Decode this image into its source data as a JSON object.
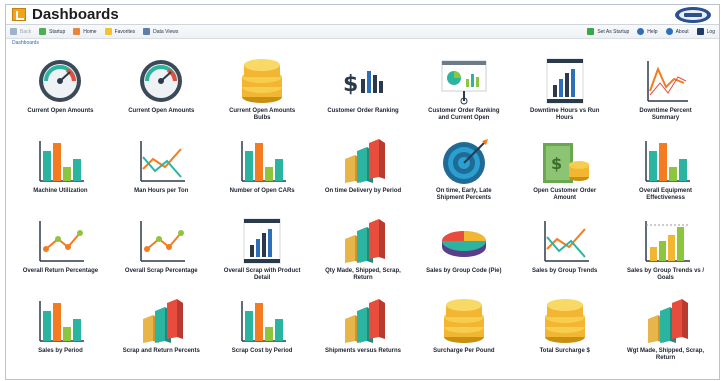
{
  "app": {
    "title": "Dashboards"
  },
  "toolbar": {
    "back": "Back",
    "startup": "Startup",
    "home": "Home",
    "favorites": "Favorites",
    "data_views": "Data Views",
    "set_as_startup": "Set As Startup",
    "help": "Help",
    "about": "About",
    "log": "Log"
  },
  "breadcrumb": "Dashboards",
  "tiles": [
    {
      "label": "Current Open Amounts",
      "icon": "gauge-icon"
    },
    {
      "label": "Current Open Amounts",
      "icon": "gauge-icon"
    },
    {
      "label": "Current Open Amounts Bulbs",
      "icon": "coins-icon"
    },
    {
      "label": "Customer Order Ranking",
      "icon": "dollar-bars-icon"
    },
    {
      "label": "Customer Order Ranking and Current Open",
      "icon": "presentation-icon"
    },
    {
      "label": "Downtime Hours vs Run Hours",
      "icon": "bar-board-icon"
    },
    {
      "label": "Downtime Percent Summary",
      "icon": "trend-line-icon"
    },
    {
      "label": "Machine Utilization",
      "icon": "bar-chart-icon"
    },
    {
      "label": "Man Hours per Ton",
      "icon": "line-chart-icon"
    },
    {
      "label": "Number of Open CARs",
      "icon": "bar-chart-icon"
    },
    {
      "label": "On time Delivery by Period",
      "icon": "3d-bars-icon"
    },
    {
      "label": "On time, Early, Late Shipment Percents",
      "icon": "target-icon"
    },
    {
      "label": "Open Customer Order Amount",
      "icon": "money-icon"
    },
    {
      "label": "Overall Equipment Effectiveness",
      "icon": "bar-chart-icon"
    },
    {
      "label": "Overall Return Percentage",
      "icon": "dot-line-icon"
    },
    {
      "label": "Overall Scrap Percentage",
      "icon": "dot-line-icon"
    },
    {
      "label": "Overall Scrap with Product Detail",
      "icon": "bar-board-icon"
    },
    {
      "label": "Qty Made, Shipped, Scrap, Return",
      "icon": "3d-bars-icon"
    },
    {
      "label": "Sales by Group Code (Pie)",
      "icon": "pie-icon"
    },
    {
      "label": "Sales by Group Trends",
      "icon": "line-chart-icon"
    },
    {
      "label": "Sales by Group Trends vs / Goals",
      "icon": "goal-bars-icon"
    },
    {
      "label": "Sales by Period",
      "icon": "bar-chart-icon"
    },
    {
      "label": "Scrap and Return Percents",
      "icon": "3d-bars-icon"
    },
    {
      "label": "Scrap Cost by Period",
      "icon": "bar-chart-icon"
    },
    {
      "label": "Shipments versus Returns",
      "icon": "3d-bars-icon"
    },
    {
      "label": "Surcharge Per Pound",
      "icon": "coins-icon"
    },
    {
      "label": "Total Surcharge $",
      "icon": "coins-icon"
    },
    {
      "label": "Wgt Made, Shipped, Scrap, Return",
      "icon": "3d-bars-icon"
    }
  ],
  "colors": {
    "accent": "#f1a31d",
    "link": "#2a6ab5",
    "teal": "#2bb5a0",
    "orange": "#f47b20",
    "green": "#8cc63f",
    "red": "#e84c3d"
  }
}
